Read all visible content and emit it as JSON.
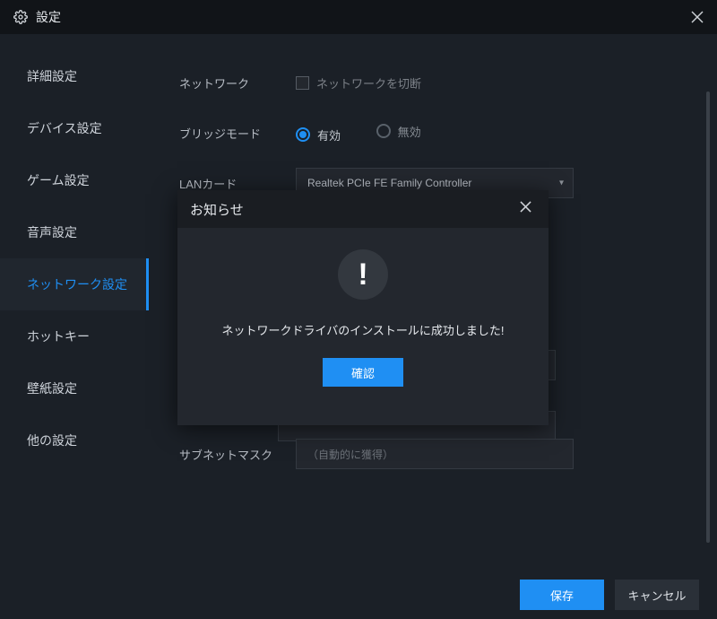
{
  "titlebar": {
    "title": "設定"
  },
  "sidebar": {
    "items": [
      {
        "label": "詳細設定"
      },
      {
        "label": "デバイス設定"
      },
      {
        "label": "ゲーム設定"
      },
      {
        "label": "音声設定"
      },
      {
        "label": "ネットワーク設定",
        "active": true
      },
      {
        "label": "ホットキー"
      },
      {
        "label": "壁紙設定"
      },
      {
        "label": "他の設定"
      }
    ]
  },
  "network": {
    "section_label": "ネットワーク",
    "disconnect_checkbox_label": "ネットワークを切断",
    "bridge_mode_label": "ブリッジモード",
    "bridge_enabled_option": "有効",
    "bridge_disabled_option": "無効",
    "lan_card_label": "LANカード",
    "lan_card_value": "Realtek PCIe FE Family Controller",
    "subnet_label": "サブネットマスク",
    "subnet_placeholder": "（自動的に獲得）"
  },
  "buttons": {
    "save": "保存",
    "cancel": "キャンセル"
  },
  "modal": {
    "title": "お知らせ",
    "icon_glyph": "!",
    "message": "ネットワークドライバのインストールに成功しました!",
    "confirm": "確認"
  }
}
